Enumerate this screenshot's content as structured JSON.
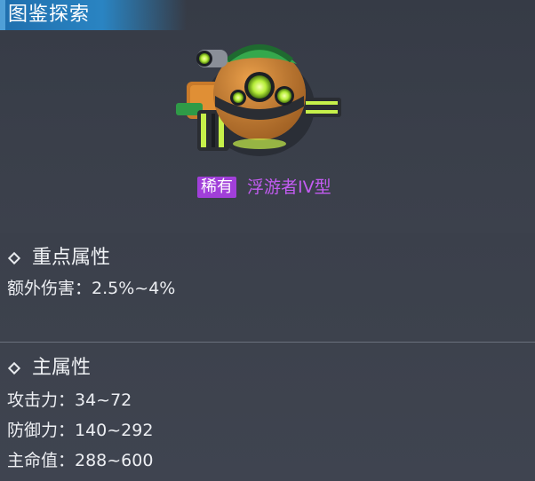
{
  "header": {
    "title": "图鉴探索"
  },
  "item": {
    "rarity": "稀有",
    "name": "浮游者IV型",
    "colors": {
      "rarity_badge": "#a13fd9",
      "name_text": "#c35cf2"
    },
    "image_icon": "floating-robot-icon"
  },
  "key_attributes": {
    "title": "重点属性",
    "icon": "diamond-icon",
    "stats": [
      {
        "text": "额外伤害：2.5%~4%"
      }
    ]
  },
  "main_attributes": {
    "title": "主属性",
    "icon": "diamond-icon",
    "stats": [
      {
        "text": "攻击力：34~72"
      },
      {
        "text": "防御力：140~292"
      },
      {
        "text": "主命值：288~600"
      }
    ]
  }
}
